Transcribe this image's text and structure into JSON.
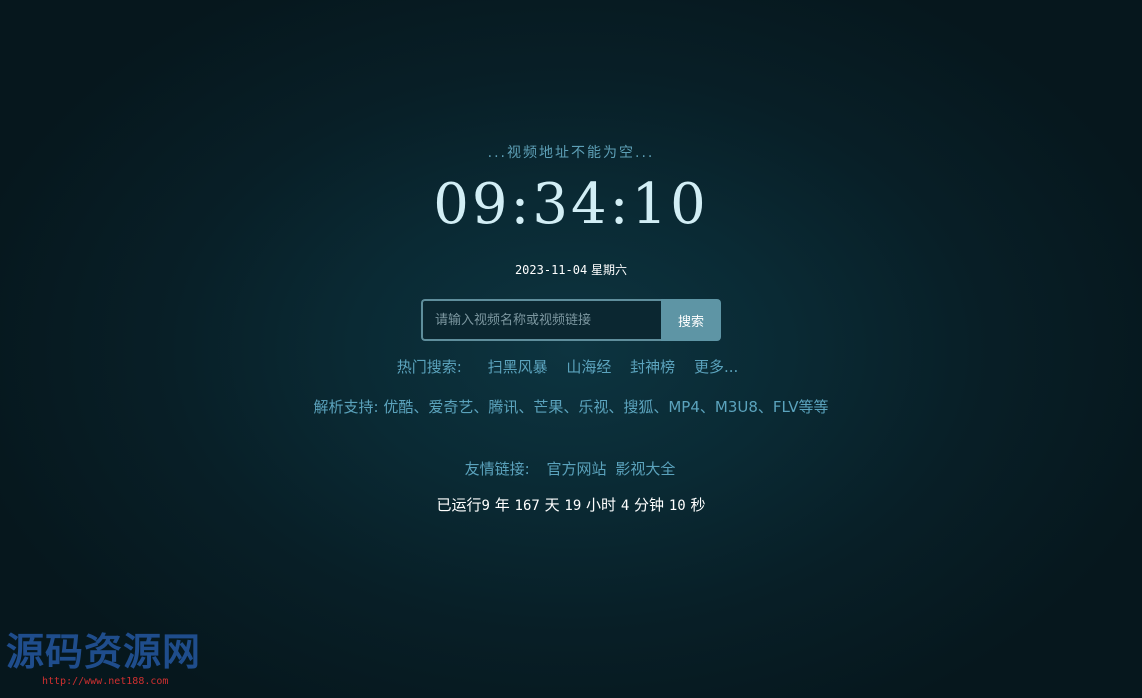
{
  "status_text": "...视频地址不能为空...",
  "clock": "09:34:10",
  "date": {
    "ymd": "2023-11-04",
    "weekday": "星期六"
  },
  "search": {
    "placeholder": "请输入视频名称或视频链接",
    "value": "",
    "button_label": "搜索"
  },
  "hot_search": {
    "label": "热门搜索:",
    "items": [
      "扫黑风暴",
      "山海经",
      "封神榜"
    ],
    "more_label": "更多..."
  },
  "support": {
    "text": "解析支持: 优酷、爱奇艺、腾讯、芒果、乐视、搜狐、MP4、M3U8、FLV等等"
  },
  "friend_links": {
    "label": "友情链接:",
    "items": [
      "官方网站",
      "影视大全"
    ]
  },
  "uptime": {
    "prefix": "已运行",
    "years": "9",
    "years_unit": "年",
    "days": "167",
    "days_unit": "天",
    "hours": "19",
    "hours_unit": "小时",
    "minutes": "4",
    "minutes_unit": "分钟",
    "seconds": "10",
    "seconds_unit": "秒"
  },
  "watermark": {
    "title": "源码资源网",
    "url": "http://www.net188.com"
  },
  "colors": {
    "background": "#0a2a34",
    "accent": "#5ba3bd",
    "clock": "#d2eef5",
    "button": "#5e95a5"
  }
}
